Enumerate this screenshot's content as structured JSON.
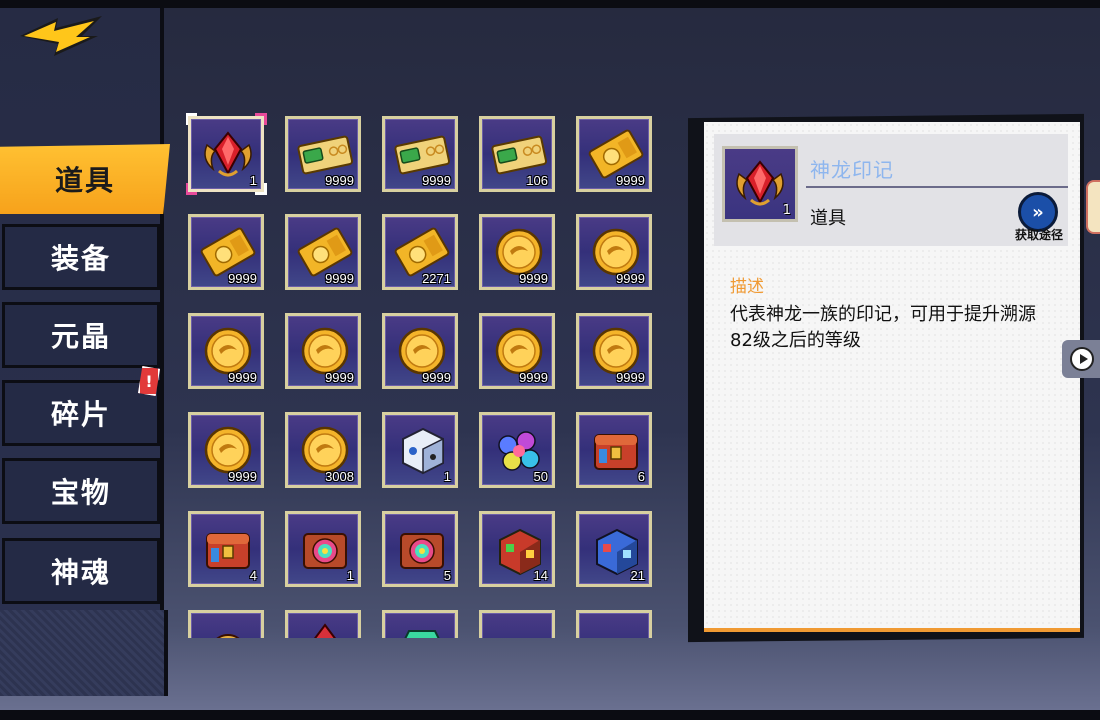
{
  "sidebar": {
    "tabs": [
      {
        "label": "道具",
        "active": true
      },
      {
        "label": "装备",
        "active": false
      },
      {
        "label": "元晶",
        "active": false
      },
      {
        "label": "碎片",
        "active": false,
        "alert": "!"
      },
      {
        "label": "宝物",
        "active": false
      },
      {
        "label": "神魂",
        "active": false
      }
    ]
  },
  "items": [
    {
      "icon": "dragon-seal-icon",
      "count": "1",
      "selected": true
    },
    {
      "icon": "green-ticket-icon",
      "count": "9999"
    },
    {
      "icon": "green-ticket-icon",
      "count": "9999"
    },
    {
      "icon": "green-ticket-icon",
      "count": "106"
    },
    {
      "icon": "gold-ticket-icon",
      "count": "9999"
    },
    {
      "icon": "gold-ticket-icon",
      "count": "9999"
    },
    {
      "icon": "gold-ticket-icon",
      "count": "9999"
    },
    {
      "icon": "gold-ticket-icon",
      "count": "2271"
    },
    {
      "icon": "gold-coin-icon",
      "count": "9999"
    },
    {
      "icon": "gold-coin-icon",
      "count": "9999"
    },
    {
      "icon": "gold-coin-icon",
      "count": "9999"
    },
    {
      "icon": "gold-coin-icon",
      "count": "9999"
    },
    {
      "icon": "gold-coin-icon",
      "count": "9999"
    },
    {
      "icon": "gold-coin-icon",
      "count": "9999"
    },
    {
      "icon": "gold-coin-icon",
      "count": "9999"
    },
    {
      "icon": "gold-coin-icon",
      "count": "9999"
    },
    {
      "icon": "gold-coin-icon",
      "count": "3008"
    },
    {
      "icon": "dice-box-icon",
      "count": "1"
    },
    {
      "icon": "gem-cluster-icon",
      "count": "50"
    },
    {
      "icon": "red-chest-icon",
      "count": "6"
    },
    {
      "icon": "red-chest-icon",
      "count": "4"
    },
    {
      "icon": "rainbow-chest-icon",
      "count": "1"
    },
    {
      "icon": "rainbow-chest-icon",
      "count": "5"
    },
    {
      "icon": "red-cube-box-icon",
      "count": "14"
    },
    {
      "icon": "blue-cube-box-icon",
      "count": "21"
    },
    {
      "icon": "red-orb-icon",
      "count": ""
    },
    {
      "icon": "red-crystal-icon",
      "count": ""
    },
    {
      "icon": "green-gem-icon",
      "count": ""
    },
    {
      "icon": "blue-creature-icon",
      "count": ""
    },
    {
      "icon": "blue-creature-icon",
      "count": ""
    }
  ],
  "detail": {
    "icon": "dragon-seal-icon",
    "count": "1",
    "name": "神龙印记",
    "type": "道具",
    "acquire_label": "获取途径",
    "desc_title": "描述",
    "desc_text": "代表神龙一族的印记，可用于提升溯源82级之后的等级"
  },
  "colors": {
    "accent": "#f7a21b",
    "panel": "#f6f6f6",
    "name": "#8eb6ee",
    "desc_title": "#f09a33",
    "slot": "#3a3480"
  }
}
